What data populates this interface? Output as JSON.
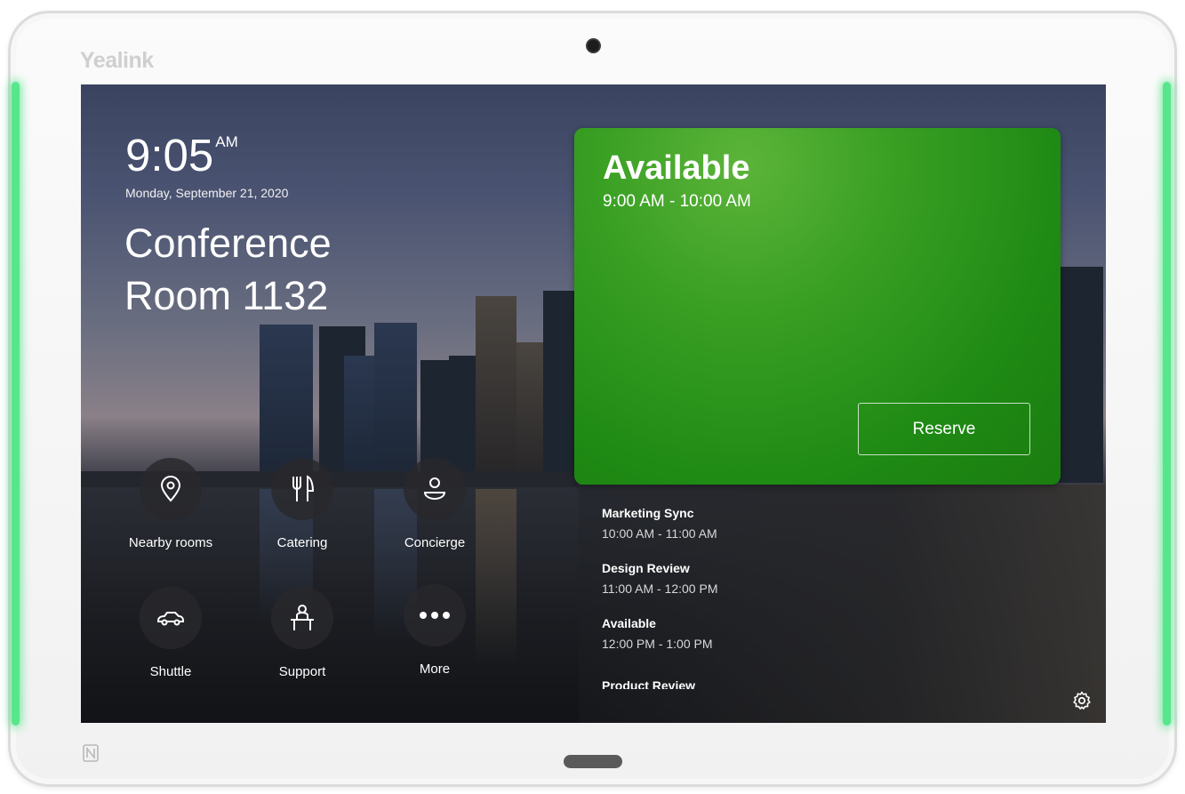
{
  "device": {
    "brand": "Yealink"
  },
  "clock": {
    "time": "9:05",
    "ampm": "AM",
    "date": "Monday, September 21, 2020"
  },
  "room": {
    "name_line1": "Conference",
    "name_line2": "Room 1132"
  },
  "tiles": [
    {
      "label": "Nearby rooms",
      "icon": "location-pin-icon"
    },
    {
      "label": "Catering",
      "icon": "fork-knife-icon"
    },
    {
      "label": "Concierge",
      "icon": "concierge-icon"
    },
    {
      "label": "Shuttle",
      "icon": "car-icon"
    },
    {
      "label": "Support",
      "icon": "support-desk-icon"
    },
    {
      "label": "More",
      "icon": "more-dots-icon"
    }
  ],
  "status": {
    "title": "Available",
    "time_range": "9:00 AM - 10:00 AM",
    "reserve_label": "Reserve",
    "color": "#2a9418"
  },
  "schedule": [
    {
      "title": "Marketing Sync",
      "time": "10:00 AM - 11:00 AM"
    },
    {
      "title": "Design Review",
      "time": "11:00 AM - 12:00 PM"
    },
    {
      "title": "Available",
      "time": "12:00 PM - 1:00 PM"
    },
    {
      "title": "Product Review",
      "time": ""
    }
  ],
  "colors": {
    "led": "#58e68c",
    "accent_green": "#2a9418"
  }
}
